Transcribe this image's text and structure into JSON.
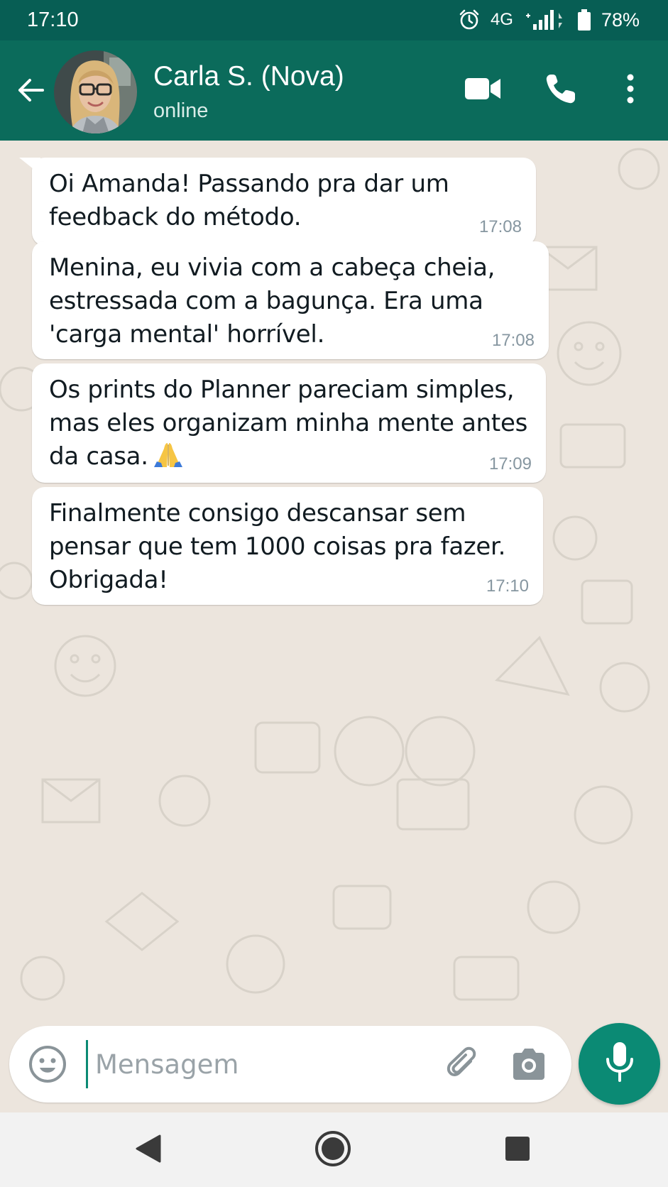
{
  "status_bar": {
    "time": "17:10",
    "network": "4G",
    "battery": "78%",
    "icons": [
      "alarm-icon",
      "signal-icon",
      "battery-icon"
    ]
  },
  "header": {
    "contact_name": "Carla S. (Nova)",
    "contact_status": "online",
    "icons": [
      "back-arrow-icon",
      "video-call-icon",
      "phone-icon",
      "more-options-icon"
    ]
  },
  "messages": [
    {
      "lines": [
        "Oi Amanda! Passando pra dar um",
        "feedback do método."
      ],
      "time": "17:08"
    },
    {
      "lines": [
        "Menina, eu vivia com a cabeça cheia,",
        "estressada com a bagunça. Era uma",
        "'carga mental' horrível."
      ],
      "time": "17:08"
    },
    {
      "lines": [
        "Os prints do Planner pareciam simples,",
        "mas eles organizam minha mente antes",
        "da casa."
      ],
      "emoji": "folded-hands-emoji",
      "time": "17:09"
    },
    {
      "lines": [
        "Finalmente consigo descansar sem",
        "pensar que tem 1000 coisas pra fazer.",
        "Obrigada!"
      ],
      "time": "17:10"
    }
  ],
  "composer": {
    "placeholder": "Mensagem",
    "icons": [
      "emoji-icon",
      "attach-icon",
      "camera-icon",
      "mic-icon"
    ]
  },
  "nav_bar": {
    "icons": [
      "back-nav-icon",
      "home-nav-icon",
      "recents-nav-icon"
    ]
  },
  "colors": {
    "header": "#0b6b5b",
    "status_bar": "#075e54",
    "accent": "#0b8a74",
    "chat_background": "#ece5dd",
    "bubble": "#ffffff",
    "timestamp": "#8696a0"
  }
}
